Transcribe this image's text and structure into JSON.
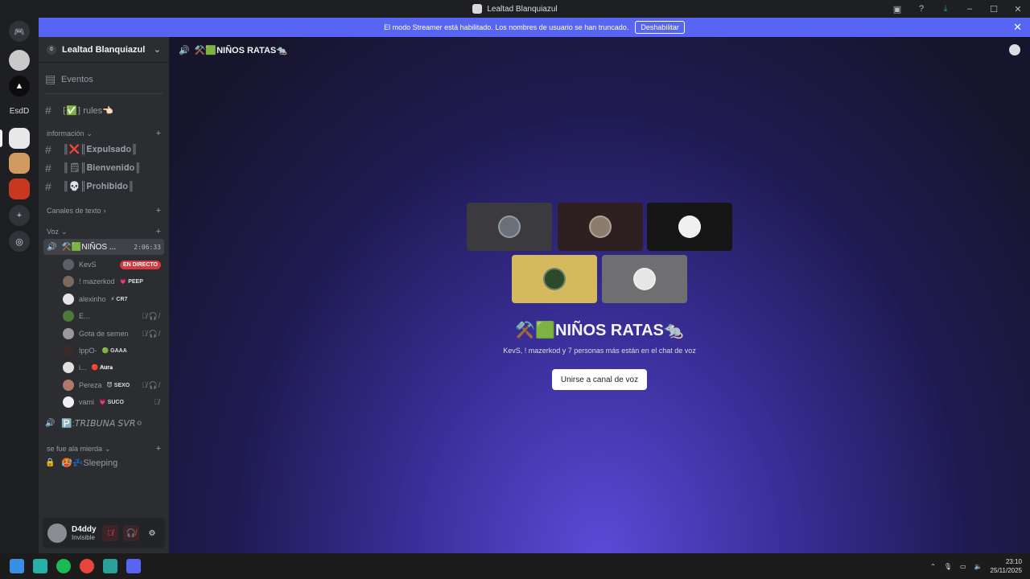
{
  "window": {
    "title": "Lealtad Blanquiazul",
    "controls": [
      "inbox-icon",
      "help-icon",
      "download-icon",
      "minimize-icon",
      "maximize-icon",
      "close-icon"
    ]
  },
  "banner": {
    "message": "El modo Streamer está habilitado. Los nombres de usuario se han truncado.",
    "button": "Deshabilitar"
  },
  "rail": {
    "folder_label": "EsdD"
  },
  "server": {
    "name": "Lealtad Blanquiazul",
    "badge": "0",
    "events_label": "Eventos",
    "rules_channel": "⁅✅⁆ rules👈🏻",
    "categories": {
      "informacion": "información",
      "canales_texto": "Canales de texto",
      "voz": "Voz",
      "se_fue": "se fue ala mierda"
    },
    "info_channels": [
      "║❌║𝐄𝐱𝐩𝐮𝐥𝐬𝐚𝐝𝐨║",
      "║🗒║𝐁𝐢𝐞𝐧𝐯𝐞𝐧𝐢𝐝𝐨║",
      "║💀║𝐏𝐫𝐨𝐡𝐢𝐛𝐢𝐝𝐨║"
    ],
    "active_voice": {
      "name": "⚒️🟩NIÑOS ...",
      "timer": "2:06:33"
    },
    "members": [
      {
        "name": "KevS",
        "tag": "",
        "live": "EN DIRECTO",
        "muted": ""
      },
      {
        "name": "! mazerkod",
        "tag": "💗 PEEP",
        "live": "",
        "muted": ""
      },
      {
        "name": "alexinho",
        "tag": "⚡ CR7",
        "live": "",
        "muted": ""
      },
      {
        "name": "E...",
        "tag": "",
        "live": "",
        "muted": "🎙̸🎧̸"
      },
      {
        "name": "Gota de semen",
        "tag": "",
        "live": "",
        "muted": "🎙̸🎧̸"
      },
      {
        "name": "IppO-",
        "tag": "🟢 GAAA",
        "live": "",
        "muted": ""
      },
      {
        "name": "i...",
        "tag": "🔴 𝐀𝐮𝐫𝐚",
        "live": "",
        "muted": ""
      },
      {
        "name": "Pereza",
        "tag": "😈 SEXO",
        "live": "",
        "muted": "🎙̸🎧̸"
      },
      {
        "name": "vami",
        "tag": "💗 SUCO",
        "live": "",
        "muted": "🎙̸"
      }
    ],
    "other_voice": "🅿️:𝘛𝘙𝘐𝘉𝘜𝘕𝘈 𝘚𝘝𝘙⚪",
    "sleeping": "🥵💤Sleeping"
  },
  "user": {
    "name": "D4ddy",
    "status": "Invisible"
  },
  "main": {
    "channel_header": "⚒️🟩NIÑOS RATAS🐀",
    "vc_title": "⚒️🟩NIÑOS RATAS🐀",
    "vc_subtitle": "KevS, ! mazerkod y 7 personas más están en el chat de voz",
    "join_button": "Unirse a canal de voz"
  },
  "taskbar": {
    "time": "23:10",
    "date": "25/11/2025"
  },
  "colors": {
    "accent": "#5865f2",
    "live": "#da373c",
    "sidebar": "#2b2d31",
    "rail": "#1e1f22"
  }
}
